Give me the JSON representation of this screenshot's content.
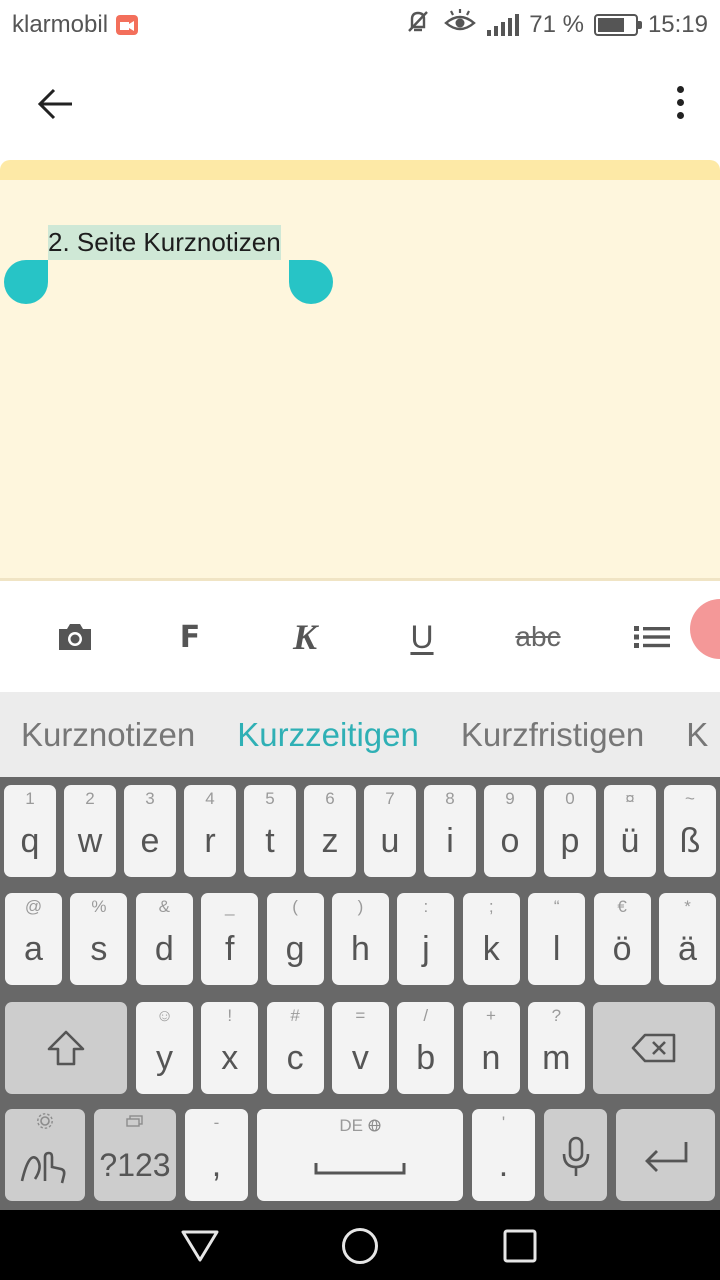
{
  "status_bar": {
    "carrier": "klarmobil",
    "notification_icons": [
      "video-app-icon",
      "keyboard-app-icon"
    ],
    "system_icons": [
      "mute-icon",
      "eye-comfort-icon",
      "signal-icon"
    ],
    "battery_text": "71 %",
    "battery_level": 0.71,
    "time": "15:19"
  },
  "app_bar": {
    "back_icon": "arrow-left-icon",
    "menu_icon": "more-vert-icon"
  },
  "note": {
    "selected_text": "2. Seite Kurznotizen",
    "background_color": "#fef6dd",
    "selection_color": "#cfe8d6",
    "handle_color": "#27c4c6"
  },
  "format_toolbar": {
    "camera_icon": "camera-icon",
    "bold_label": "F",
    "italic_label": "K",
    "underline_label": "U",
    "strike_label": "abc",
    "list_icon": "bullet-list-icon"
  },
  "suggestions": [
    "Kurznotizen",
    "Kurzzeitigen",
    "Kurzfristigen",
    "K"
  ],
  "suggestion_highlight_color": "#2fb0b5",
  "keyboard": {
    "row1": [
      {
        "hint": "1",
        "key": "q"
      },
      {
        "hint": "2",
        "key": "w"
      },
      {
        "hint": "3",
        "key": "e"
      },
      {
        "hint": "4",
        "key": "r"
      },
      {
        "hint": "5",
        "key": "t"
      },
      {
        "hint": "6",
        "key": "z"
      },
      {
        "hint": "7",
        "key": "u"
      },
      {
        "hint": "8",
        "key": "i"
      },
      {
        "hint": "9",
        "key": "o"
      },
      {
        "hint": "0",
        "key": "p"
      },
      {
        "hint": "¤",
        "key": "ü"
      },
      {
        "hint": "~",
        "key": "ß"
      }
    ],
    "row2": [
      {
        "hint": "@",
        "key": "a"
      },
      {
        "hint": "%",
        "key": "s"
      },
      {
        "hint": "&",
        "key": "d"
      },
      {
        "hint": "_",
        "key": "f"
      },
      {
        "hint": "(",
        "key": "g"
      },
      {
        "hint": ")",
        "key": "h"
      },
      {
        "hint": ":",
        "key": "j"
      },
      {
        "hint": ";",
        "key": "k"
      },
      {
        "hint": "“",
        "key": "l"
      },
      {
        "hint": "€",
        "key": "ö"
      },
      {
        "hint": "*",
        "key": "ä"
      }
    ],
    "row3": [
      {
        "hint": "☺",
        "key": "y"
      },
      {
        "hint": "!",
        "key": "x"
      },
      {
        "hint": "#",
        "key": "c"
      },
      {
        "hint": "=",
        "key": "v"
      },
      {
        "hint": "/",
        "key": "b"
      },
      {
        "hint": "+",
        "key": "n"
      },
      {
        "hint": "?",
        "key": "m"
      }
    ],
    "symbols_label": "?123",
    "comma_hint": "-",
    "comma_key": ",",
    "space_hint": "DE",
    "period_hint": "'",
    "period_key": "."
  },
  "nav_bar": {
    "back": "nav-back-icon",
    "home": "nav-home-icon",
    "recents": "nav-recents-icon"
  }
}
